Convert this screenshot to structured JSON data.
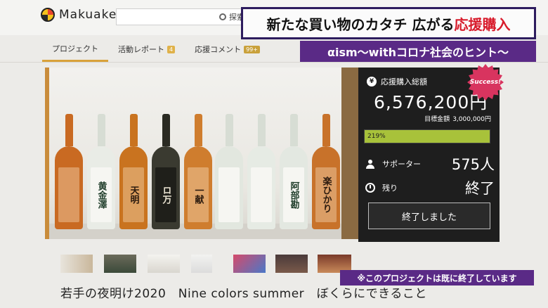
{
  "header": {
    "logo_text": "Makuake",
    "search_label": "探索"
  },
  "tabs": [
    {
      "label": "プロジェクト",
      "badge": ""
    },
    {
      "label": "活動レポート",
      "badge": "4"
    },
    {
      "label": "応援コメント",
      "badge": "99+"
    }
  ],
  "telop": {
    "line1_main": "新たな買い物のカタチ 広がる",
    "line1_accent": "応援購入",
    "line2": "αism～withコロナ社会のヒント～"
  },
  "hero": {
    "bottle_labels": [
      "",
      "黄金澤",
      "天明",
      "ロ万",
      "一献",
      "",
      "",
      "阿部勘",
      "楽ひかり"
    ],
    "bottle_colors": [
      "#c96a22",
      "#e9ece6",
      "#c9731f",
      "#3a3a30",
      "#cf7d2e",
      "#e2e7df",
      "#e6ebe4",
      "#e3e8e1",
      "#c8722a"
    ]
  },
  "stats": {
    "title": "応援購入総額",
    "amount": "6,576,200円",
    "goal_label": "目標金額",
    "goal_value": "3,000,000円",
    "progress_text": "219%",
    "progress_percent": 100,
    "supporters_label": "サポーター",
    "supporters_value": "575人",
    "remaining_label": "残り",
    "remaining_value": "終了",
    "end_button": "終了しました",
    "success_badge": "Success!"
  },
  "bottom": {
    "project_title": "若手の夜明け2020　Nine colors summer　ぼくらにできること",
    "notice": "※このプロジェクトは既に終了しています"
  }
}
